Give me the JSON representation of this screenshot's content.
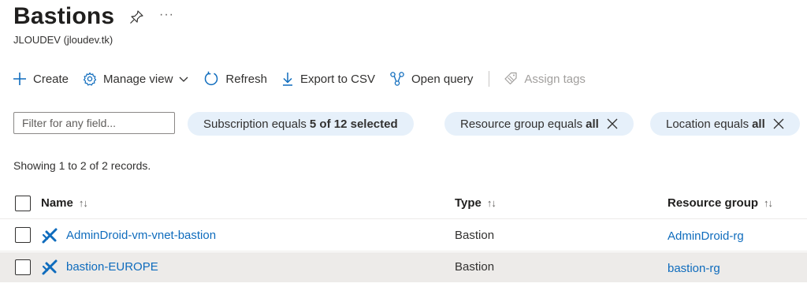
{
  "header": {
    "title": "Bastions",
    "more_label": "···",
    "subtitle": "JLOUDEV (jloudev.tk)"
  },
  "toolbar": {
    "create": "Create",
    "manage_view": "Manage view",
    "refresh": "Refresh",
    "export_csv": "Export to CSV",
    "open_query": "Open query",
    "assign_tags": "Assign tags"
  },
  "filters": {
    "placeholder": "Filter for any field...",
    "subscription": {
      "label": "Subscription equals",
      "value": "5 of 12 selected"
    },
    "resource_group": {
      "label": "Resource group equals",
      "value": "all"
    },
    "location": {
      "label": "Location equals",
      "value": "all"
    }
  },
  "records_text": "Showing 1 to 2 of 2 records.",
  "table": {
    "columns": {
      "name": "Name",
      "type": "Type",
      "resource_group": "Resource group"
    },
    "sort_name": "↑↓",
    "sort_type": "↑↓",
    "sort_rg": "↑↓",
    "rows": [
      {
        "name": "AdminDroid-vm-vnet-bastion",
        "type": "Bastion",
        "resource_group": "AdminDroid-rg"
      },
      {
        "name": "bastion-EUROPE",
        "type": "Bastion",
        "resource_group": "bastion-rg"
      }
    ]
  },
  "colors": {
    "accent": "#0f6cbd",
    "pill_bg": "#e6f0fa",
    "selected_row": "#edebe9"
  }
}
